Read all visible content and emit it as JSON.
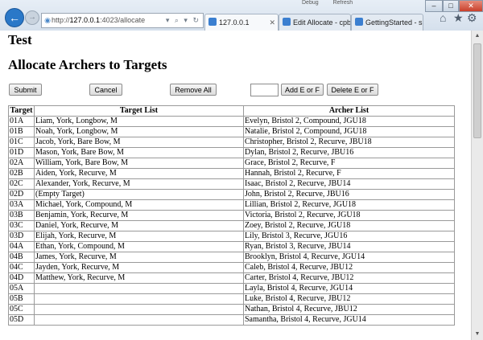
{
  "browser": {
    "menu": [
      "Debug",
      "Refresh"
    ],
    "url": {
      "scheme": "http://",
      "host": "127.0.0.1",
      "rest": ":4023/allocate",
      "controls": "▾ ⌕ ▾ ↻"
    },
    "tabs": [
      {
        "label": "127.0.0.1",
        "active": true
      },
      {
        "label": "Edit Allocate - cpbs...",
        "active": false
      },
      {
        "label": "GettingStarted - su...",
        "active": false
      }
    ],
    "window_controls": {
      "minimize": "–",
      "maximize": "□",
      "close": "✕"
    },
    "tab_close": "✕",
    "toolbar_icons": {
      "home": "⌂",
      "favorites": "★",
      "tools": "⚙"
    },
    "nav": {
      "back": "←",
      "forward": "→"
    },
    "scroll": {
      "up": "▲",
      "down": "▼"
    }
  },
  "page": {
    "title": "Test",
    "heading": "Allocate Archers to Targets",
    "buttons": {
      "submit": "Submit",
      "cancel": "Cancel",
      "remove_all": "Remove All",
      "add": "Add E or F",
      "delete": "Delete E or F"
    },
    "ef_value": "",
    "table": {
      "headers": [
        "Target",
        "Target List",
        "Archer List"
      ],
      "rows": [
        [
          "01A",
          "Liam, York, Longbow, M",
          "Evelyn, Bristol 2, Compound, JGU18"
        ],
        [
          "01B",
          "Noah, York, Longbow, M",
          "Natalie, Bristol 2, Compound, JGU18"
        ],
        [
          "01C",
          "Jacob, York, Bare Bow, M",
          "Christopher, Bristol 2, Recurve, JBU18"
        ],
        [
          "01D",
          "Mason, York, Bare Bow, M",
          "Dylan, Bristol 2, Recurve, JBU16"
        ],
        [
          "02A",
          "William, York, Bare Bow, M",
          "Grace, Bristol 2, Recurve, F"
        ],
        [
          "02B",
          "Aiden, York, Recurve, M",
          "Hannah, Bristol 2, Recurve, F"
        ],
        [
          "02C",
          "Alexander, York, Recurve, M",
          "Isaac, Bristol 2, Recurve, JBU14"
        ],
        [
          "02D",
          "(Empty Target)",
          "John, Bristol 2, Recurve, JBU16"
        ],
        [
          "03A",
          "Michael, York, Compound, M",
          "Lillian, Bristol 2, Recurve, JGU18"
        ],
        [
          "03B",
          "Benjamin, York, Recurve, M",
          "Victoria, Bristol 2, Recurve, JGU18"
        ],
        [
          "03C",
          "Daniel, York, Recurve, M",
          "Zoey, Bristol 2, Recurve, JGU18"
        ],
        [
          "03D",
          "Elijah, York, Recurve, M",
          "Lily, Bristol 3, Recurve, JGU16"
        ],
        [
          "04A",
          "Ethan, York, Compound, M",
          "Ryan, Bristol 3, Recurve, JBU14"
        ],
        [
          "04B",
          "James, York, Recurve, M",
          "Brooklyn, Bristol 4, Recurve, JGU14"
        ],
        [
          "04C",
          "Jayden, York, Recurve, M",
          "Caleb, Bristol 4, Recurve, JBU12"
        ],
        [
          "04D",
          "Matthew, York, Recurve, M",
          "Carter, Bristol 4, Recurve, JBU12"
        ],
        [
          "05A",
          "",
          "Layla, Bristol 4, Recurve, JGU14"
        ],
        [
          "05B",
          "",
          "Luke, Bristol 4, Recurve, JBU12"
        ],
        [
          "05C",
          "",
          "Nathan, Bristol 4, Recurve, JBU12"
        ],
        [
          "05D",
          "",
          "Samantha, Bristol 4, Recurve, JGU14"
        ]
      ]
    }
  }
}
